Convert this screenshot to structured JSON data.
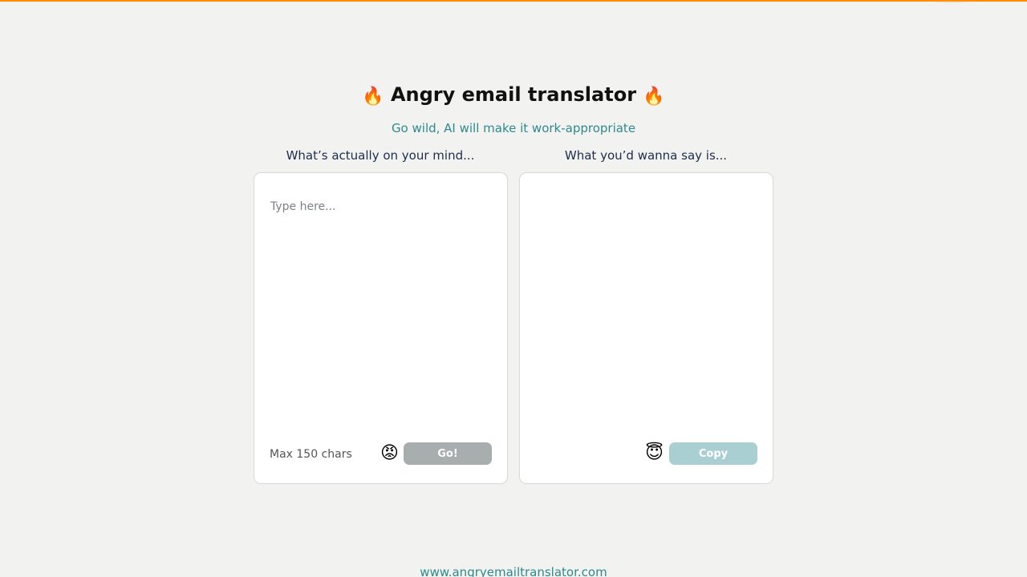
{
  "header": {
    "title_icon_left": "🔥",
    "title": "Angry email translator",
    "title_icon_right": "🔥",
    "subtitle": "Go wild, AI will make it work-appropriate"
  },
  "input_panel": {
    "label": "What’s actually on your mind...",
    "placeholder": "Type here...",
    "char_limit": "Max 150 chars",
    "emoji": "😡",
    "button_label": "Go!"
  },
  "output_panel": {
    "label": "What you’d wanna say is...",
    "output_text": "",
    "emoji": "😇",
    "button_label": "Copy"
  },
  "footer": {
    "url": "www.angryemailtranslator.com"
  },
  "colors": {
    "accent": "#ff8a00",
    "teal": "#2e8a8a",
    "go_button": "#a8aeae",
    "copy_button": "#a9cfd3",
    "background": "#f2f2f1"
  }
}
